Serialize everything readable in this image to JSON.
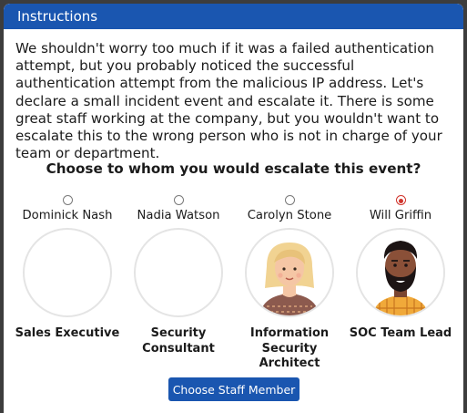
{
  "window": {
    "title": "Instructions"
  },
  "instructions_text": "We shouldn't worry too much if it was a failed authentication attempt, but you probably noticed the successful authentication attempt from the malicious IP address. Let's declare a small incident event and escalate it. There is some great staff working at the company, but you wouldn't want to escalate this to the wrong person who is not in charge of your team or department.",
  "question": "Choose to whom you would escalate this event?",
  "staff": [
    {
      "name": "Dominick Nash",
      "role": "Sales Executive",
      "selected": false,
      "avatar": "empty"
    },
    {
      "name": "Nadia Watson",
      "role": "Security Consultant",
      "selected": false,
      "avatar": "empty"
    },
    {
      "name": "Carolyn Stone",
      "role": "Information Security Architect",
      "selected": false,
      "avatar": "blonde-woman-portrait"
    },
    {
      "name": "Will Griffin",
      "role": "SOC Team Lead",
      "selected": true,
      "avatar": "bearded-man-portrait"
    }
  ],
  "action_button_label": "Choose Staff Member",
  "colors": {
    "accent": "#1a56b0",
    "radio_selected": "#d0342c"
  }
}
